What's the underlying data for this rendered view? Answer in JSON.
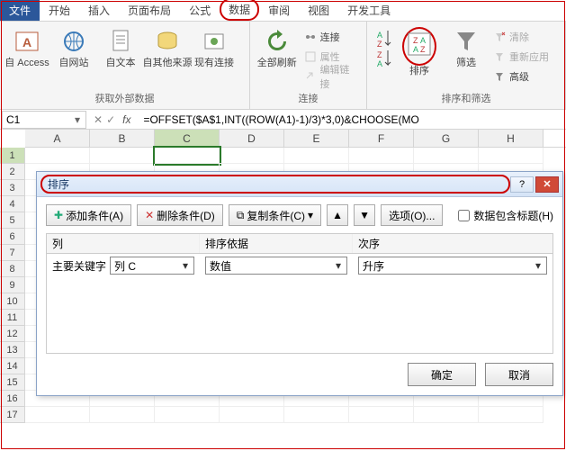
{
  "tabs": {
    "file": "文件",
    "home": "开始",
    "insert": "插入",
    "layout": "页面布局",
    "formula": "公式",
    "data": "数据",
    "review": "审阅",
    "view": "视图",
    "dev": "开发工具"
  },
  "ribbon": {
    "ext": {
      "access": "自 Access",
      "web": "自网站",
      "text": "自文本",
      "other": "自其他来源",
      "existing": "现有连接",
      "group": "获取外部数据"
    },
    "conn": {
      "refresh": "全部刷新",
      "connections": "连接",
      "properties": "属性",
      "editlinks": "编辑链接",
      "group": "连接"
    },
    "sort": {
      "sort": "排序",
      "filter": "筛选",
      "clear": "清除",
      "reapply": "重新应用",
      "advanced": "高级",
      "group": "排序和筛选"
    }
  },
  "namebox": "C1",
  "formula": "=OFFSET($A$1,INT((ROW(A1)-1)/3)*3,0)&CHOOSE(MO",
  "columns": [
    "A",
    "B",
    "C",
    "D",
    "E",
    "F",
    "G",
    "H"
  ],
  "rows": [
    "1",
    "2",
    "3",
    "4",
    "5",
    "6",
    "7",
    "8",
    "9",
    "10",
    "11",
    "12",
    "13",
    "14",
    "15",
    "16",
    "17"
  ],
  "dialog": {
    "title": "排序",
    "add": "添加条件(A)",
    "del": "删除条件(D)",
    "copy": "复制条件(C)",
    "options": "选项(O)...",
    "header_chk": "数据包含标题(H)",
    "col_header": "列",
    "sortby_header": "排序依据",
    "order_header": "次序",
    "primary_label": "主要关键字",
    "primary_col": "列 C",
    "primary_basis": "数值",
    "primary_order": "升序",
    "ok": "确定",
    "cancel": "取消"
  }
}
